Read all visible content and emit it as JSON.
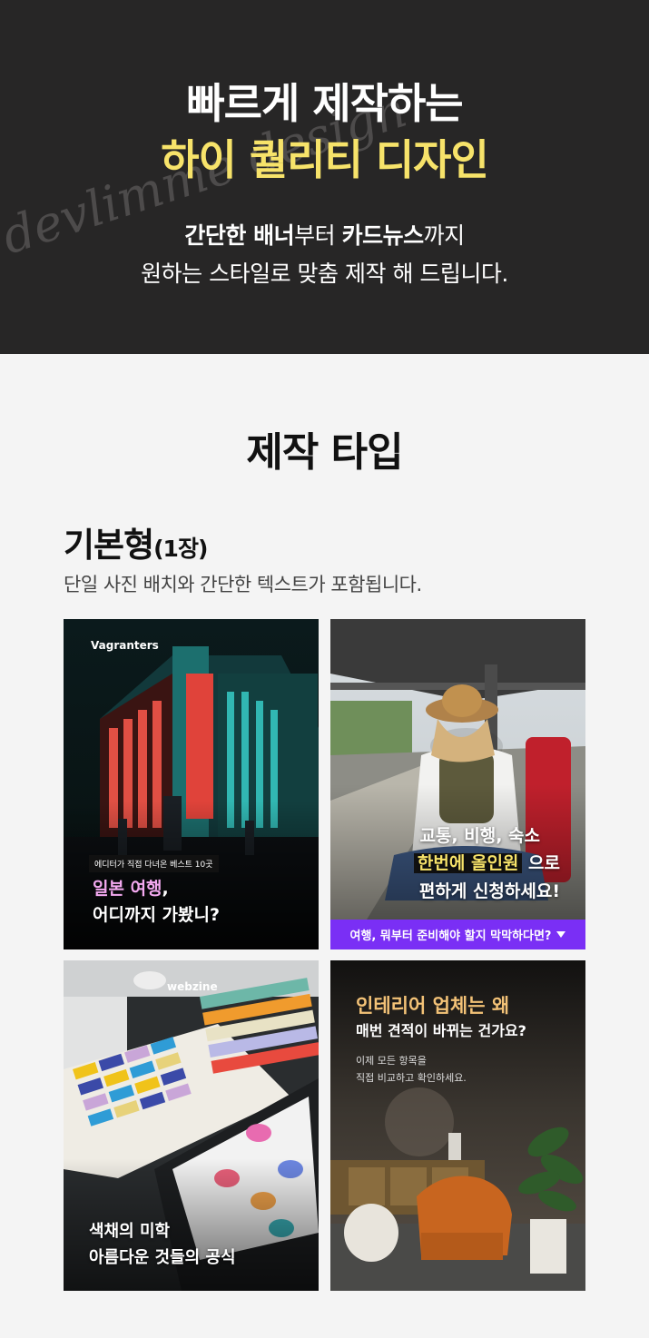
{
  "hero": {
    "line1": "빠르게 제작하는",
    "line2": "하이 퀄리티 디자인",
    "sub1_bold1": "간단한 배너",
    "sub1_mid": "부터 ",
    "sub1_bold2": "카드뉴스",
    "sub1_end": "까지",
    "sub2": "원하는 스타일로 맞춤 제작 해 드립니다.",
    "script_text": "devlimme design"
  },
  "section": {
    "title": "제작 타입",
    "type_name": "기본형",
    "type_count": "(1장)",
    "type_desc": "단일 사진 배치와 간단한 텍스트가 포함됩니다."
  },
  "cards": [
    {
      "brand": "Vagranters",
      "tag": "에디터가 직접 다녀온 베스트 10곳",
      "title1_a": "일본 여행",
      "title1_b": ",",
      "title2": "어디까지 가봤니?"
    },
    {
      "line1": "교통, 비행, 숙소",
      "line2_hl": "한번에 올인원",
      "line2_rest": " 으로",
      "line3": "편하게 신청하세요!",
      "bar": "여행, 뭐부터 준비해야 할지 막막하다면?"
    },
    {
      "brand": "webzine",
      "title1": "색채의 미학",
      "title2": "아름다운 것들의 공식"
    },
    {
      "title1": "인테리어 업체는 왜",
      "title2": "매번 견적이 바뀌는 건가요?",
      "sub1": "이제 모든 항목을",
      "sub2": "직접 비교하고 확인하세요."
    }
  ],
  "colors": {
    "hero_bg": "#272626",
    "hero_accent": "#f7e36a",
    "page_bg": "#f4f4f4",
    "purple_bar": "#7a2ff5",
    "pink_text": "#f3a9f0",
    "orange_text": "#f3c277"
  }
}
